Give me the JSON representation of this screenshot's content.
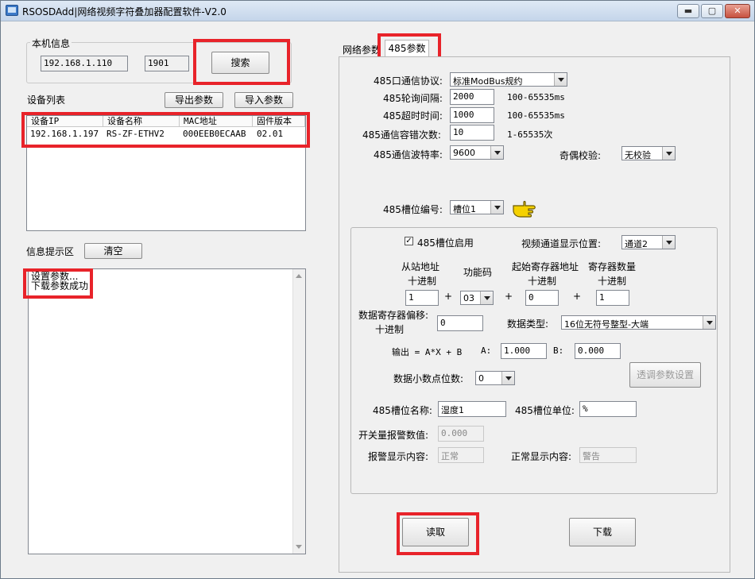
{
  "window": {
    "title": "RSOSDAdd|网络视频字符叠加器配置软件-V2.0",
    "minimize_label": "▬",
    "maximize_label": "▢",
    "close_label": "✕"
  },
  "local_info": {
    "group_title": "本机信息",
    "ip_value": "192.168.1.110",
    "port_value": "1901",
    "search_label": "搜索"
  },
  "device_list": {
    "title": "设备列表",
    "export_label": "导出参数",
    "import_label": "导入参数",
    "columns": [
      "设备IP",
      "设备名称",
      "MAC地址",
      "固件版本"
    ],
    "rows": [
      {
        "ip": "192.168.1.197",
        "name": "RS-ZF-ETHV2",
        "mac": "000EEB0ECAAB",
        "fw": "02.01"
      }
    ]
  },
  "info_area": {
    "title": "信息提示区",
    "clear_label": "清空",
    "lines": [
      "设置参数...",
      "下载参数成功"
    ]
  },
  "tabs": {
    "network_label": "网络参数",
    "rs485_label": "485参数"
  },
  "rs485": {
    "protocol_label": "485口通信协议:",
    "protocol_value": "标准ModBus规约",
    "poll_label": "485轮询间隔:",
    "poll_value": "2000",
    "poll_range": "100-65535ms",
    "timeout_label": "485超时时间:",
    "timeout_value": "1000",
    "timeout_range": "100-65535ms",
    "retry_label": "485通信容错次数:",
    "retry_value": "10",
    "retry_range": "1-65535次",
    "baud_label": "485通信波特率:",
    "baud_value": "9600",
    "parity_label": "奇偶校验:",
    "parity_value": "无校验",
    "slot_label": "485槽位编号:",
    "slot_value": "槽位1"
  },
  "slot": {
    "enable_check": "✓",
    "enable_label": "485槽位启用",
    "video_pos_label": "视频通道显示位置:",
    "video_pos_value": "通道2",
    "slave_label_1": "从站地址",
    "slave_label_2": "十进制",
    "func_label": "功能码",
    "start_reg_label_1": "起始寄存器地址",
    "start_reg_label_2": "十进制",
    "reg_count_label_1": "寄存器数量",
    "reg_count_label_2": "十进制",
    "plus": "+",
    "slave_value": "1",
    "func_value": "03",
    "start_reg_value": "0",
    "reg_count_value": "1",
    "offset_label_1": "数据寄存器偏移:",
    "offset_label_2": "十进制",
    "offset_value": "0",
    "data_type_label": "数据类型:",
    "data_type_value": "16位无符号整型-大端",
    "output_label": "输出 = A*X + B",
    "a_label": "A:",
    "a_value": "1.000",
    "b_label": "B:",
    "b_value": "0.000",
    "decimals_label": "数据小数点位数:",
    "decimals_value": "0",
    "adv_button_label": "透调参数设置",
    "name_label": "485槽位名称:",
    "name_value": "湿度1",
    "unit_label": "485槽位单位:",
    "unit_value": "%",
    "alarm_value_label": "开关量报警数值:",
    "alarm_value": "0.000",
    "alarm_text_label": "报警显示内容:",
    "alarm_text_value": "正常",
    "normal_text_label": "正常显示内容:",
    "normal_text_value": "警告"
  },
  "actions": {
    "read_label": "读取",
    "download_label": "下载"
  }
}
